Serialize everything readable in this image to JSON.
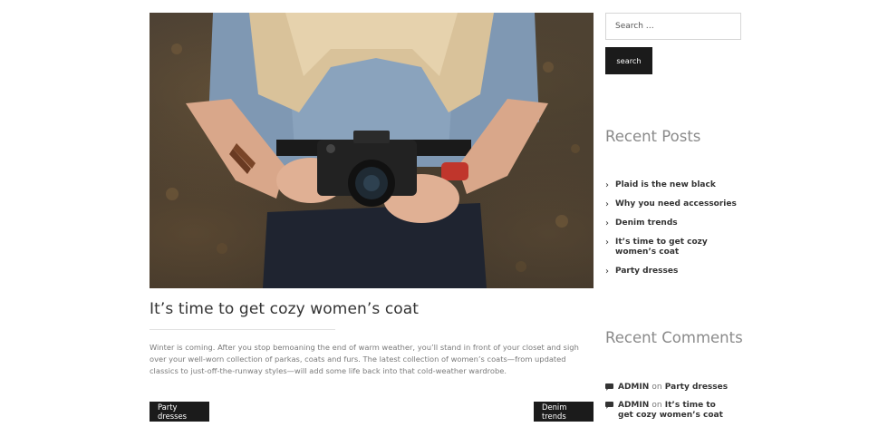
{
  "post": {
    "hero_alt": "Woman holding a vintage camera",
    "title": "It’s time to get cozy women’s coat",
    "excerpt": "Winter is coming. After you stop bemoaning the end of warm weather, you’ll stand in front of your closet and sigh over your well-worn collection of parkas, coats and furs. The latest collection of women’s coats—from updated classics to just-off-the-runway styles—will add some life back into that cold-weather wardrobe.",
    "prev_label": "Party dresses",
    "next_label": "Denim trends"
  },
  "sidebar": {
    "search": {
      "placeholder": "Search …",
      "button_label": "search"
    },
    "recent_posts": {
      "title": "Recent Posts",
      "items": [
        "Plaid is the new black",
        "Why you need accessories",
        "Denim trends",
        "It’s time to get cozy women’s coat",
        "Party dresses"
      ]
    },
    "recent_comments": {
      "title": "Recent Comments",
      "items": [
        {
          "author": "ADMIN",
          "on": "on",
          "post": "Party dresses"
        },
        {
          "author": "ADMIN",
          "on": "on",
          "post": "It’s time to get cozy women’s coat"
        }
      ]
    }
  }
}
